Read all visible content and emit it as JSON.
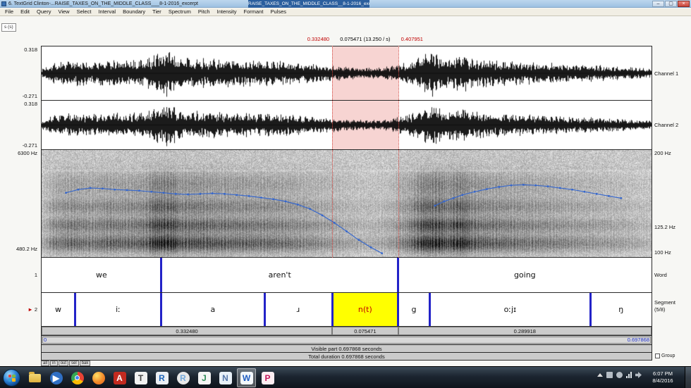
{
  "window": {
    "title": "6. TextGrid Clinton-...RAISE_TAXES_ON_THE_MIDDLE_CLASS___8-1-2016_excerpt",
    "overlay_title": "RAISE_TAXES_ON_THE_MIDDLE_CLASS__8-1-2016_excerpt",
    "minimize_label": "–",
    "maximize_label": "▢",
    "close_label": "×"
  },
  "menu_items": [
    "File",
    "Edit",
    "Query",
    "View",
    "Select",
    "Interval",
    "Boundary",
    "Tier",
    "Spectrum",
    "Pitch",
    "Intensity",
    "Formant",
    "Pulses"
  ],
  "corner_tab_label": "s (s)",
  "selection": {
    "start_s": 0.33248,
    "end_s": 0.407951,
    "start_label": "0.332480",
    "duration_label": "0.075471 (13.250 / s)",
    "end_label": "0.407951"
  },
  "total_duration_s": 0.697868,
  "channels": [
    {
      "top_label": "0.318",
      "bottom_label": "-0.271",
      "name": "Channel 1"
    },
    {
      "top_label": "0.318",
      "bottom_label": "-0.271",
      "name": "Channel 2"
    }
  ],
  "spectrogram": {
    "left_top_label": "6300 Hz",
    "left_cursor_label": "480.2 Hz",
    "right_top_label": "200 Hz",
    "right_cursor_label": "125.2 Hz",
    "right_bottom_label": "100 Hz",
    "pitch_segments": [
      [
        [
          0.04,
          0.4
        ],
        [
          0.06,
          0.37
        ],
        [
          0.08,
          0.355
        ],
        [
          0.1,
          0.36
        ],
        [
          0.12,
          0.37
        ],
        [
          0.14,
          0.375
        ],
        [
          0.16,
          0.38
        ],
        [
          0.18,
          0.39
        ],
        [
          0.2,
          0.4
        ],
        [
          0.22,
          0.41
        ],
        [
          0.24,
          0.415
        ],
        [
          0.26,
          0.41
        ],
        [
          0.28,
          0.405
        ],
        [
          0.3,
          0.41
        ],
        [
          0.32,
          0.42
        ],
        [
          0.34,
          0.43
        ],
        [
          0.36,
          0.445
        ],
        [
          0.38,
          0.46
        ],
        [
          0.4,
          0.48
        ],
        [
          0.42,
          0.51
        ],
        [
          0.44,
          0.55
        ],
        [
          0.46,
          0.61
        ],
        [
          0.48,
          0.68
        ],
        [
          0.5,
          0.76
        ],
        [
          0.52,
          0.84
        ],
        [
          0.54,
          0.91
        ],
        [
          0.558,
          0.965
        ]
      ],
      [
        [
          0.645,
          0.52
        ],
        [
          0.66,
          0.48
        ],
        [
          0.675,
          0.45
        ],
        [
          0.69,
          0.42
        ],
        [
          0.71,
          0.39
        ],
        [
          0.73,
          0.365
        ],
        [
          0.75,
          0.345
        ],
        [
          0.77,
          0.33
        ],
        [
          0.79,
          0.325
        ],
        [
          0.81,
          0.33
        ],
        [
          0.83,
          0.34
        ],
        [
          0.85,
          0.355
        ],
        [
          0.87,
          0.37
        ],
        [
          0.89,
          0.39
        ],
        [
          0.91,
          0.41
        ],
        [
          0.93,
          0.43
        ],
        [
          0.95,
          0.45
        ]
      ]
    ]
  },
  "tiers": [
    {
      "number": "1",
      "name": "Word",
      "suffix": "",
      "intervals": [
        {
          "label": "we",
          "start": 0,
          "end": 0.137
        },
        {
          "label": "aren't",
          "start": 0.137,
          "end": 0.407951
        },
        {
          "label": "going",
          "start": 0.407951,
          "end": 0.697868
        }
      ]
    },
    {
      "number": "2",
      "name": "Segment",
      "suffix": "(5/8)",
      "selected": true,
      "intervals": [
        {
          "label": "w",
          "start": 0,
          "end": 0.038
        },
        {
          "label": "iː",
          "start": 0.038,
          "end": 0.137
        },
        {
          "label": "a",
          "start": 0.137,
          "end": 0.255
        },
        {
          "label": "ɹ",
          "start": 0.255,
          "end": 0.33248
        },
        {
          "label": "n(t)",
          "start": 0.33248,
          "end": 0.407951,
          "selected": true
        },
        {
          "label": "g",
          "start": 0.407951,
          "end": 0.444
        },
        {
          "label": "oːjɪ",
          "start": 0.444,
          "end": 0.628
        },
        {
          "label": "ŋ",
          "start": 0.628,
          "end": 0.697868
        }
      ]
    }
  ],
  "time_bar": [
    {
      "label": "0.332480",
      "start": 0,
      "end": 0.33248
    },
    {
      "label": "0.075471",
      "start": 0.33248,
      "end": 0.407951
    },
    {
      "label": "0.289918",
      "start": 0.407951,
      "end": 0.697868
    }
  ],
  "scrollbar": {
    "left_label": "0",
    "right_label": "0.697868"
  },
  "visible_part_label": "Visible part 0.697868 seconds",
  "total_duration_label": "Total duration 0.697868 seconds",
  "mini_buttons": [
    "all",
    "in",
    "out",
    "sel",
    "bak"
  ],
  "group_label": "Group",
  "taskbar": {
    "icons": [
      "windows-explorer",
      "windows-media-player",
      "google-chrome",
      "firefox",
      "adobe-reader",
      "texworks",
      "r-project",
      "rstudio",
      "jabref",
      "notepad",
      "microsoft-word",
      "praat"
    ],
    "active_icon": "microsoft-word",
    "clock_time": "6:07 PM",
    "clock_date": "8/4/2016"
  },
  "colors": {
    "selection_pink": "#f7d4d2",
    "selection_red": "#c23b32",
    "boundary_blue": "#2323c8",
    "pitch_blue": "#3566cc",
    "highlight_yellow": "#ffff00",
    "label_red": "#c00000",
    "label_blue": "#2233cc"
  }
}
